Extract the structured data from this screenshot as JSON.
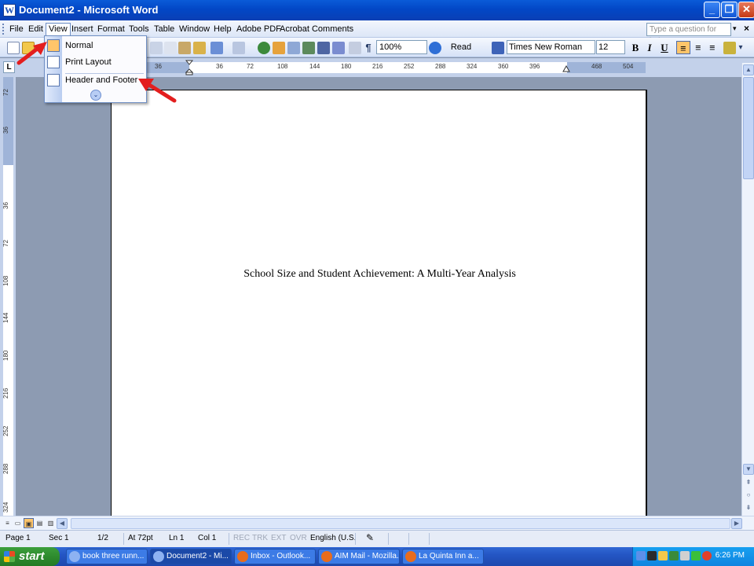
{
  "window": {
    "title": "Document2 - Microsoft Word",
    "app_icon_letter": "W",
    "controls": {
      "minimize": "_",
      "restore": "❐",
      "close": "✕"
    }
  },
  "menubar": {
    "items": [
      "File",
      "Edit",
      "View",
      "Insert",
      "Format",
      "Tools",
      "Table",
      "Window",
      "Help",
      "Adobe PDF",
      "Acrobat Comments"
    ],
    "active": "View",
    "help_placeholder": "Type a question for help",
    "help_arrow": "▾",
    "doc_close": "×"
  },
  "toolbar": {
    "zoom": "100%",
    "read_label": "Read",
    "font_name": "Times New Roman",
    "font_size": "12",
    "bold": "B",
    "italic": "I",
    "underline": "U",
    "dropdown_arrow": "▾",
    "separator": "|"
  },
  "ruler": {
    "tab_selector": "L",
    "horizontal_ticks": [
      "36",
      "36",
      "72",
      "108",
      "144",
      "180",
      "216",
      "252",
      "288",
      "324",
      "360",
      "396",
      "468",
      "504"
    ],
    "vertical_ticks": [
      "72",
      "36",
      "36",
      "72",
      "108",
      "144",
      "180",
      "216",
      "252",
      "288",
      "324"
    ]
  },
  "view_menu": {
    "items": [
      {
        "label": "Normal",
        "icon": "normal-view-icon"
      },
      {
        "label": "Print Layout",
        "icon": "print-layout-icon"
      },
      {
        "label": "Header and Footer",
        "icon": "header-footer-icon"
      }
    ],
    "expand_glyph": "⌄"
  },
  "document": {
    "title_text": "School Size and Student Achievement: A Multi-Year Analysis"
  },
  "scrollbars": {
    "up": "▲",
    "down": "▼",
    "left": "◀",
    "right": "▶",
    "prev_page": "⇞",
    "select_browse": "○",
    "next_page": "⇟"
  },
  "view_buttons": [
    "≡",
    "▭",
    "▣",
    "▤",
    "▥"
  ],
  "statusbar": {
    "page": "Page 1",
    "sec": "Sec 1",
    "page_of": "1/2",
    "at": "At 72pt",
    "ln": "Ln 1",
    "col": "Col 1",
    "rec": "REC",
    "trk": "TRK",
    "ext": "EXT",
    "ovr": "OVR",
    "language": "English (U.S.",
    "spell_glyph": "✎"
  },
  "taskbar": {
    "start_label": "start",
    "tasks": [
      {
        "label": "book three runn...",
        "color": "#5d8fe8"
      },
      {
        "label": "Document2 - Mi...",
        "color": "#5d8fe8"
      },
      {
        "label": "Inbox - Outlook...",
        "color": "#e86c1d"
      },
      {
        "label": "AIM Mail - Mozilla...",
        "color": "#e86c1d"
      },
      {
        "label": "La Quinta Inn a...",
        "color": "#e86c1d"
      }
    ],
    "clock": "6:26 PM"
  },
  "colors": {
    "annotation_arrow": "#e31e1e",
    "menu_highlight": "#ffc56a",
    "title_bar": "#0a5bd8"
  }
}
